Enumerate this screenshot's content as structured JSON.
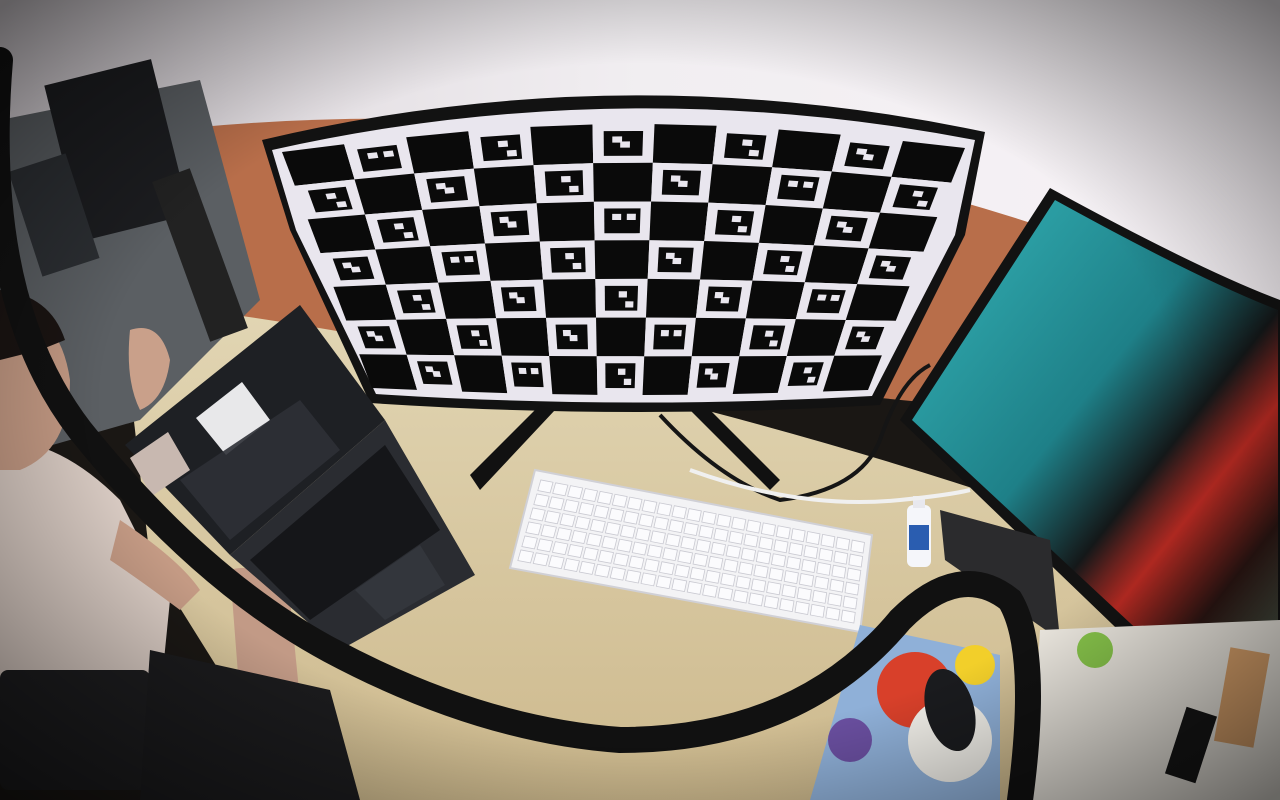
{
  "scene": {
    "description_kind": "fisheye-office-desk",
    "colors": {
      "wall": "#ece8ec",
      "desk": "#d8c9a4",
      "partition": "#b86e4a",
      "bezel": "#121212",
      "board_white": "#e9e6ee",
      "board_black": "#0a0a0a",
      "keyboard": "#f3f3f5",
      "laptop": "#24262b",
      "ocean": "#2a9aa0",
      "sunset": "#c8332a",
      "cable": "#121212",
      "mousepad_blue": "#8fb0d8"
    },
    "charuco": {
      "rows": 7,
      "cols": 11
    }
  }
}
